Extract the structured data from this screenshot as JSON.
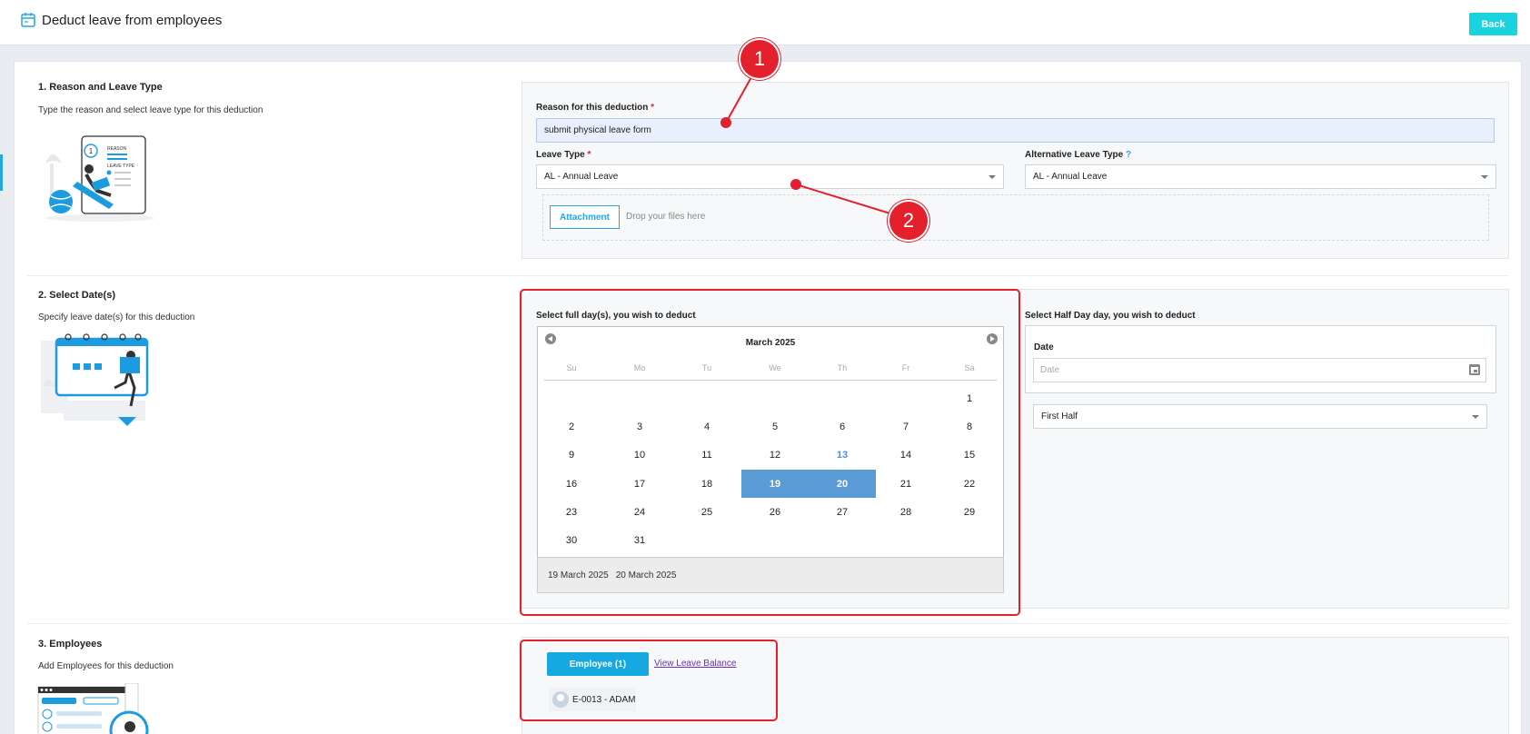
{
  "header": {
    "title": "Deduct leave from employees",
    "back_label": "Back"
  },
  "section1": {
    "title": "1. Reason and Leave Type",
    "desc": "Type the reason and select leave type for this deduction",
    "illus_text1": "REASON",
    "illus_text2": "LEAVE TYPE",
    "illus_num": "1",
    "reason_label": "Reason for this deduction",
    "required_mark": "*",
    "reason_value": "submit physical leave form",
    "leave_type_label": "Leave Type",
    "leave_type_value": "AL - Annual Leave",
    "alt_leave_label": "Alternative Leave Type",
    "alt_help": "?",
    "alt_leave_value": "AL - Annual Leave",
    "attachment_label": "Attachment",
    "drop_text": "Drop your files here"
  },
  "section2": {
    "title": "2. Select Date(s)",
    "desc": "Specify leave date(s) for this deduction",
    "full_day_label": "Select full day(s), you wish to deduct",
    "half_day_label": "Select Half Day day, you wish to deduct",
    "calendar": {
      "month": "March 2025",
      "weekdays": [
        "Su",
        "Mo",
        "Tu",
        "We",
        "Th",
        "Fr",
        "Sa"
      ],
      "first_weekday_index": 6,
      "days_in_month": 31,
      "today": 13,
      "selected": [
        19,
        20
      ]
    },
    "selected_dates": [
      "19 March 2025",
      "20 March 2025"
    ],
    "date_label": "Date",
    "date_placeholder": "Date",
    "half_option": "First Half"
  },
  "section3": {
    "title": "3. Employees",
    "desc": "Add Employees for this deduction",
    "employee_button": "Employee (1)",
    "view_balance": "View Leave Balance",
    "employee_chip": "E-0013 - ADAM"
  },
  "annotations": {
    "callout1": "1",
    "callout2": "2"
  },
  "colors": {
    "accent": "#16a9e1",
    "back_button": "#19d3e1",
    "annotation": "#e3202b",
    "selected_day": "#5b9bd5"
  }
}
